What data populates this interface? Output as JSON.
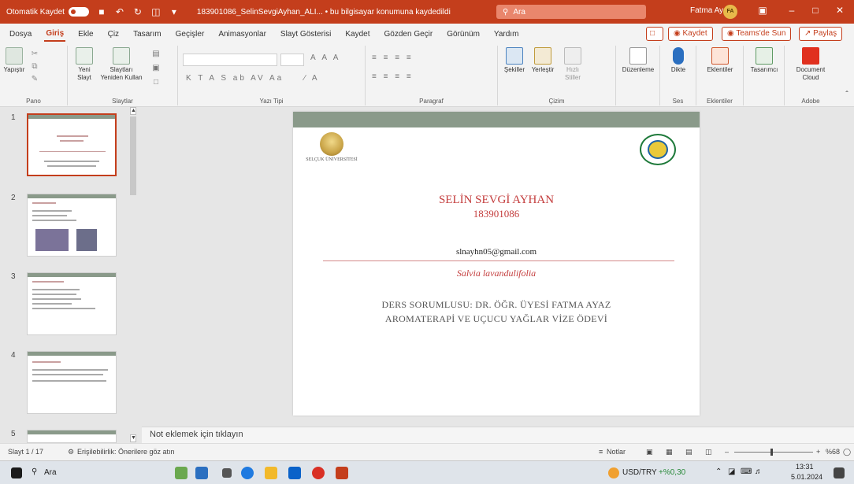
{
  "titlebar": {
    "autosave_label": "Otomatik Kaydet",
    "doc_title": "183901086_SelinSevgiAyhan_ALI... • bu bilgisayar konumuna kaydedildi",
    "search_placeholder": "Ara",
    "user_name": "Fatma Ayaz",
    "user_initials": "FA"
  },
  "tabs": [
    "Dosya",
    "Giriş",
    "Ekle",
    "Çiz",
    "Tasarım",
    "Geçişler",
    "Animasyonlar",
    "Slayt Gösterisi",
    "Kaydet",
    "Gözden Geçir",
    "Görünüm",
    "Yardım"
  ],
  "tab_actions": {
    "record": "Kaydet",
    "teams": "Teams'de Sun",
    "share": "Paylaş"
  },
  "ribbon": {
    "paste": "Yapıştır",
    "clipboard": "Pano",
    "new_slide_1": "Yeni",
    "new_slide_2": "Slayt",
    "slides_1": "Slaytları",
    "slides_2": "Yeniden Kullan",
    "slides_group": "Slaytlar",
    "font_group": "Yazı Tipi",
    "paragraph_group": "Paragraf",
    "shapes": "Şekiller",
    "arrange": "Yerleştir",
    "quick_styles_1": "Hızlı",
    "quick_styles_2": "Stiller",
    "drawing_group": "Çizim",
    "editing": "Düzenleme",
    "dictate": "Dikte",
    "voice_group": "Ses",
    "designer": "Eklentiler",
    "addins_group": "Eklentiler",
    "design": "Tasarımcı",
    "doc_cloud_1": "Document",
    "doc_cloud_2": "Cloud",
    "adobe_group": "Adobe"
  },
  "thumbnails": [
    {
      "num": "1"
    },
    {
      "num": "2"
    },
    {
      "num": "3"
    },
    {
      "num": "4"
    },
    {
      "num": "5"
    }
  ],
  "slide": {
    "university": "SELÇUK ÜNİVERSİTESİ",
    "name": "SELİN SEVGİ AYHAN",
    "student_id": "183901086",
    "email": "slnayhn05@gmail.com",
    "species": "Salvia lavandulifolia",
    "supervisor": "DERS SORUMLUSU: DR. ÖĞR. ÜYESİ FATMA AYAZ",
    "assignment": "AROMATERAPİ VE UÇUCU YAĞLAR VİZE ÖDEVİ"
  },
  "notes_placeholder": "Not eklemek için tıklayın",
  "status": {
    "slide_count": "Slayt 1 / 17",
    "accessibility": "Erişilebilirlik: Önerilere göz atın",
    "notes": "Notlar",
    "zoom": "%68"
  },
  "taskbar": {
    "search": "Ara",
    "currency": "USD/TRY",
    "currency_change": "+%0,30",
    "time": "13:31",
    "date": "5.01.2024"
  }
}
